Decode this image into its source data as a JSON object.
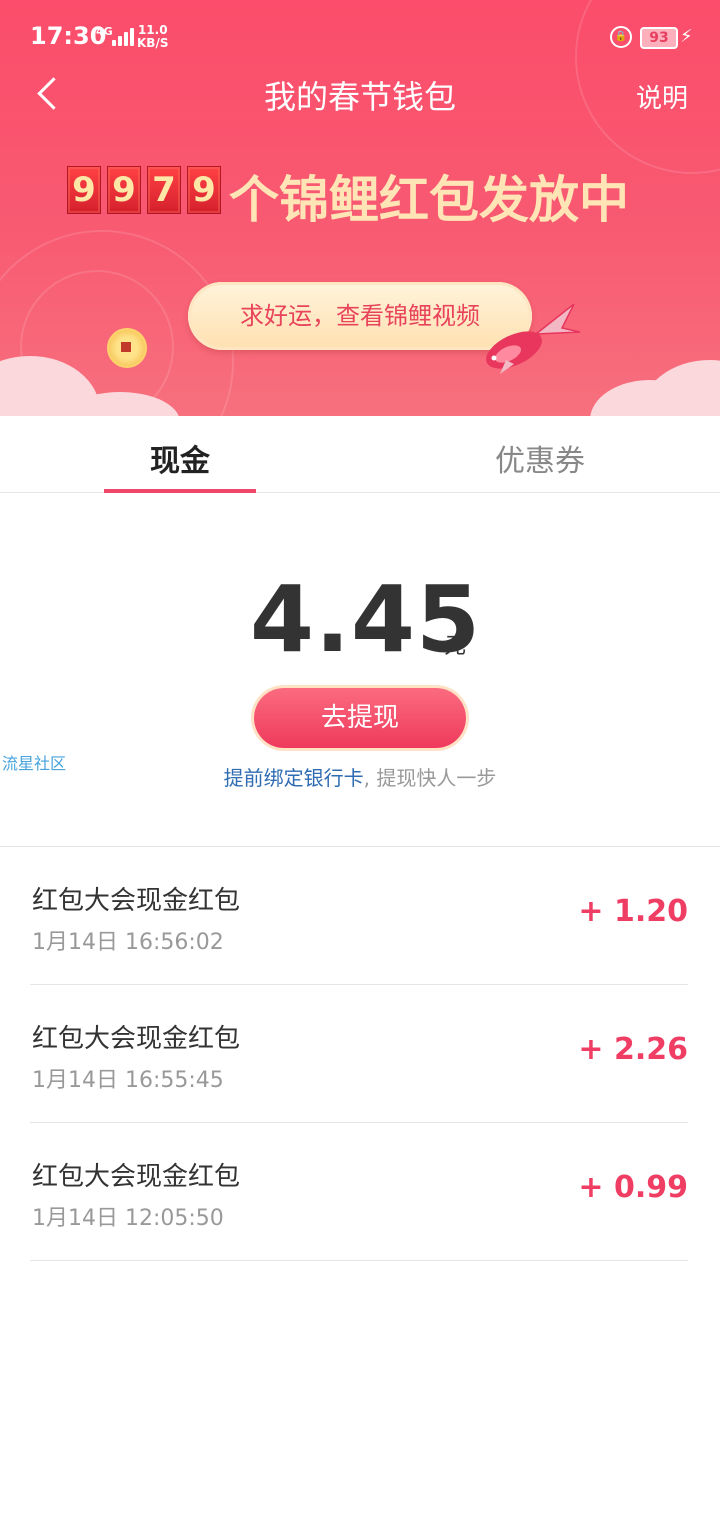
{
  "status_bar": {
    "time": "17:30",
    "network": "4G",
    "speed_value": "11.0",
    "speed_unit": "KB/S",
    "battery": "93"
  },
  "header": {
    "title": "我的春节钱包",
    "help_label": "说明"
  },
  "banner": {
    "digits": [
      "9",
      "9",
      "7",
      "9"
    ],
    "text": "个锦鲤红包发放中",
    "video_button": "求好运，查看锦鲤视频"
  },
  "tabs": {
    "cash": "现金",
    "coupon": "优惠券",
    "active": "cash"
  },
  "balance": {
    "amount": "4.45",
    "unit": "元",
    "withdraw_label": "去提现",
    "bind_link": "提前绑定银行卡",
    "bind_suffix": ", 提现快人一步"
  },
  "watermark": "流星社区",
  "transactions": [
    {
      "title": "红包大会现金红包",
      "time": "1月14日 16:56:02",
      "amount": "+ 1.20"
    },
    {
      "title": "红包大会现金红包",
      "time": "1月14日 16:55:45",
      "amount": "+ 2.26"
    },
    {
      "title": "红包大会现金红包",
      "time": "1月14日 12:05:50",
      "amount": "+ 0.99"
    }
  ],
  "colors": {
    "brand_red": "#f0466a",
    "amount_red": "#ef3d63",
    "link_blue": "#2f6cb2",
    "banner_gold": "#ffe4b6"
  }
}
